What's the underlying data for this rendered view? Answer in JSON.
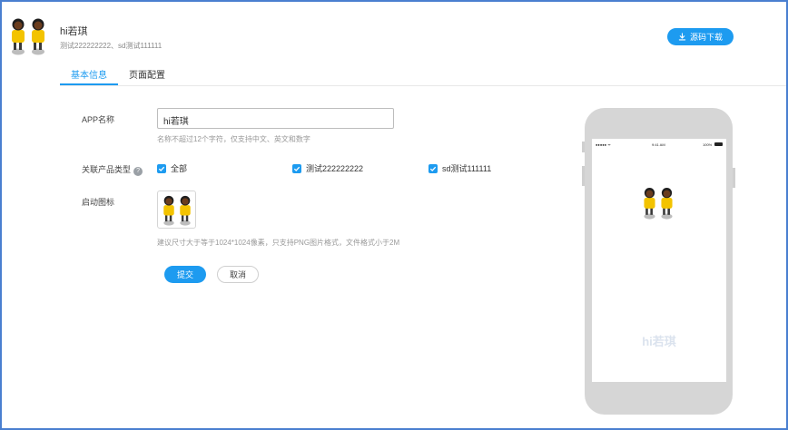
{
  "header": {
    "app_name": "hi若琪",
    "app_desc": "测试222222222、sd测试111111",
    "download_label": "源码下载"
  },
  "tabs": [
    {
      "label": "基本信息",
      "active": true
    },
    {
      "label": "页面配置",
      "active": false
    }
  ],
  "form": {
    "app_name_label": "APP名称",
    "app_name_value": "hi若琪",
    "app_name_hint": "名称不超过12个字符，仅支持中文、英文和数字",
    "product_type_label": "关联产品类型",
    "product_type_options": [
      {
        "label": "全部",
        "checked": true
      },
      {
        "label": "测试222222222",
        "checked": true
      },
      {
        "label": "sd测试111111",
        "checked": true
      }
    ],
    "launch_icon_label": "启动图标",
    "launch_icon_hint": "建议尺寸大于等于1024*1024像素，只支持PNG图片格式，文件格式小于2M",
    "submit_label": "提交",
    "cancel_label": "取消"
  },
  "preview": {
    "status_time": "9:41 AM",
    "status_battery": "100%",
    "status_signal": "●●●●● ᯤ",
    "app_name": "hi若琪"
  },
  "colors": {
    "accent": "#1d9bf0",
    "frame": "#4a7fd0",
    "phone_body": "#d6d6d6"
  }
}
